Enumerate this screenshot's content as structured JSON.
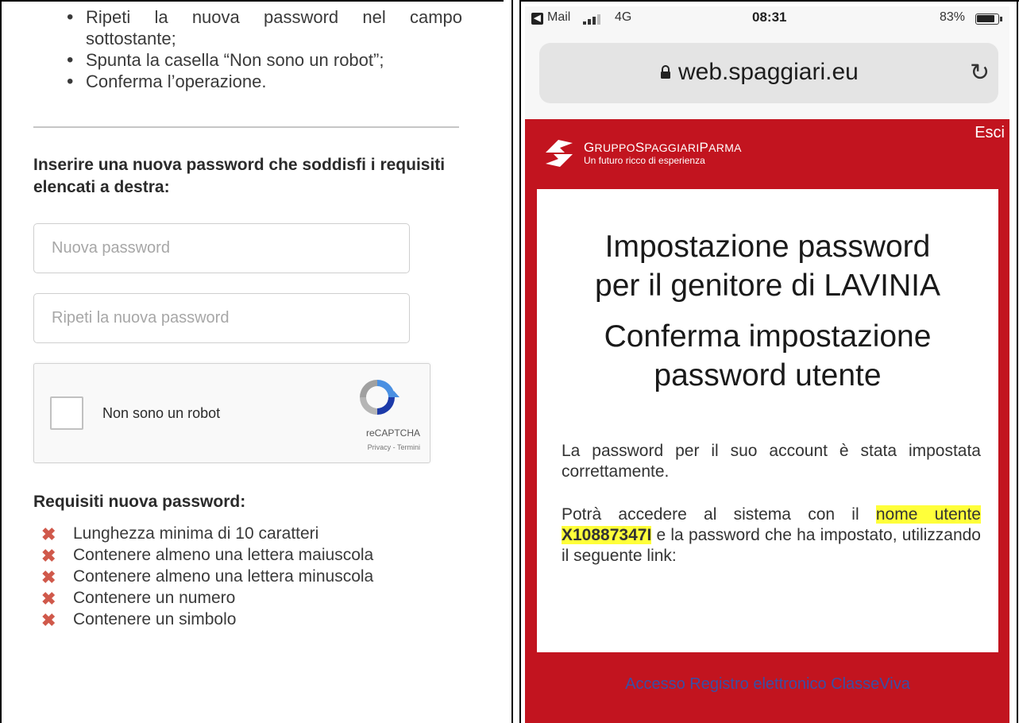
{
  "left": {
    "steps": [
      "Ripeti la nuova password nel campo",
      "sottostante;",
      "Spunta la casella “Non sono un robot”;",
      "Conferma l’operazione."
    ],
    "prompt": "Inserire una nuova password che soddisfi i requisiti elencati a destra:",
    "new_password_placeholder": "Nuova password",
    "repeat_password_placeholder": "Ripeti la nuova password",
    "captcha": {
      "label": "Non sono un robot",
      "brand": "reCAPTCHA",
      "terms": "Privacy - Termini"
    },
    "requirements_title": "Requisiti nuova password:",
    "requirements": [
      "Lunghezza minima di 10 caratteri",
      "Contenere almeno una lettera maiuscola",
      "Contenere almeno una lettera minuscola",
      "Contenere un numero",
      "Contenere un simbolo"
    ],
    "requirement_mark": "✖",
    "mark_color": "#d0594b"
  },
  "phone": {
    "status": {
      "app": "Mail",
      "network": "4G",
      "time": "08:31",
      "battery": "83%",
      "battery_level": 0.83
    },
    "url": "web.spaggiari.eu",
    "header": {
      "brand_prefix": "G",
      "brand_rest": "RUPPO",
      "brand_s": "S",
      "brand_s_rest": "PAGGIARI",
      "brand_p": "P",
      "brand_p_rest": "ARMA",
      "tagline": "Un futuro ricco di esperienza",
      "logout": "Esci",
      "brand_color": "#c2141f"
    },
    "card": {
      "title_line1": "Impostazione password",
      "title_line2": "per il genitore di LAVINIA",
      "subtitle_line1": "Conferma impostazione",
      "subtitle_line2": "password utente",
      "message": "La password per il suo account è stata impostata correttamente.",
      "access_before": "Potrà accedere al sistema con il ",
      "access_hl_label": "nome utente ",
      "access_username": "X10887347I",
      "access_after": " e la password che ha impostato, utilizzando il seguente link:",
      "link": "Accesso Registro elettronico ClasseViva",
      "highlight_color": "#ffff3a"
    }
  }
}
